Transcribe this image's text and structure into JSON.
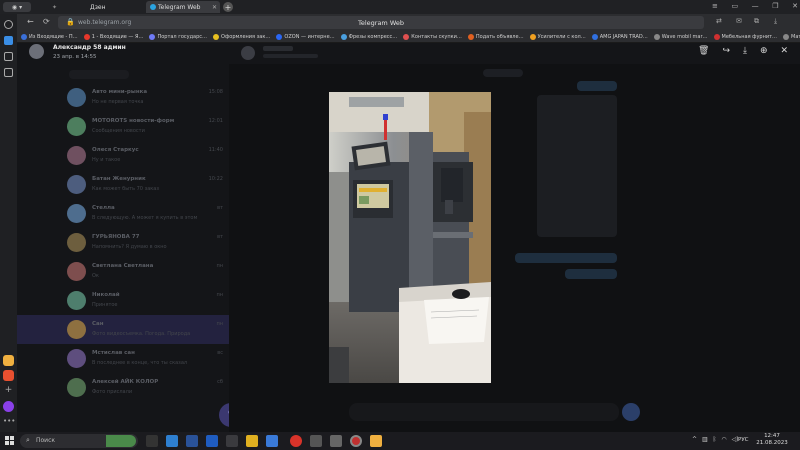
{
  "tabs": [
    {
      "label": "Дзен"
    },
    {
      "label": "Telegram Web"
    }
  ],
  "address": {
    "url": "web.telegram.org",
    "page_title": "Telegram Web"
  },
  "bookmarks": [
    {
      "label": "Из Входящие - П…",
      "color": "#3a6fd8"
    },
    {
      "label": "1 - Входящие — Я…",
      "color": "#e8372b"
    },
    {
      "label": "Портал государс…",
      "color": "#6f7bf7"
    },
    {
      "label": "Оформления зак…",
      "color": "#e8c020"
    },
    {
      "label": "OZON — интерне…",
      "color": "#2a67f5"
    },
    {
      "label": "Фрезы компресс…",
      "color": "#4aa0e0"
    },
    {
      "label": "Контакты скупки…",
      "color": "#e05050"
    },
    {
      "label": "Подать объявле…",
      "color": "#e06020"
    },
    {
      "label": "Усилители с кол…",
      "color": "#f0a020"
    },
    {
      "label": "AMG JAPAN TRAD…",
      "color": "#3070e0"
    },
    {
      "label": "Wave mobil mar…",
      "color": "#888888"
    },
    {
      "label": "Мебельная фурнит…",
      "color": "#d03030"
    },
    {
      "label": "Материалы",
      "color": "#888888"
    }
  ],
  "viewer": {
    "sender": "Александр 58 админ",
    "date": "23 апр. в 14:55"
  },
  "chats": [
    {
      "name": "Авто мини-рынка",
      "preview": "Но не первая точка",
      "time": "15:08",
      "color": "#3f5f7f"
    },
    {
      "name": "MOTOROTS новости-форм",
      "preview": "Сообщения новости",
      "time": "12:01",
      "color": "#4d7e5e"
    },
    {
      "name": "Олеся Старкус",
      "preview": "Ну и такое",
      "time": "11:40",
      "color": "#6f5060"
    },
    {
      "name": "Батан Женурник",
      "preview": "Как может быть 70 заказ",
      "time": "10:22",
      "color": "#4d5d7e"
    },
    {
      "name": "Стелла",
      "preview": "В следующую. А может я купить в этом",
      "time": "вт",
      "color": "#4e6d8e"
    },
    {
      "name": "ГУРЬЯНОВА 77",
      "preview": "Напомнить? Я думаю в окно",
      "time": "вт",
      "color": "#6d5e3e"
    },
    {
      "name": "Светлана Светлана",
      "preview": "Ок",
      "time": "пн",
      "color": "#7e4e4e"
    },
    {
      "name": "Николай",
      "preview": "Принятое",
      "time": "пн",
      "color": "#4e7e6d"
    },
    {
      "name": "Сан",
      "preview": "Фото видеосъемка. Погода. Природа",
      "time": "пн",
      "color": "#8e7040"
    },
    {
      "name": "Мстислав сан",
      "preview": "В последнее в конце, что ты сказал",
      "time": "вс",
      "color": "#5e4e7e"
    },
    {
      "name": "Алексей АЙК КОЛОР",
      "preview": "Фото прислали",
      "time": "сб",
      "color": "#4e6e4e"
    }
  ],
  "taskbar": {
    "search_label": "Поиск",
    "lang": "РУС",
    "time": "12:47",
    "date": "21.08.2023"
  }
}
